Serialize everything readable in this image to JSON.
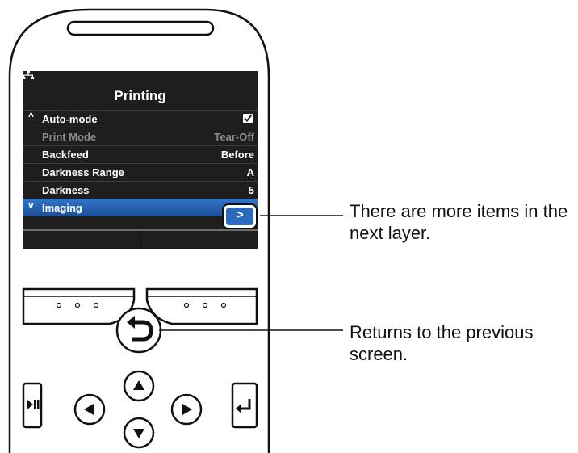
{
  "screen": {
    "title": "Printing",
    "items": [
      {
        "label": "Auto-mode",
        "value": "",
        "checked": true,
        "enabled": true,
        "prefix": "^"
      },
      {
        "label": "Print Mode",
        "value": "Tear-Off",
        "enabled": false
      },
      {
        "label": "Backfeed",
        "value": "Before",
        "enabled": true
      },
      {
        "label": "Darkness Range",
        "value": "A",
        "enabled": true
      },
      {
        "label": "Darkness",
        "value": "5",
        "enabled": true
      },
      {
        "label": "Imaging",
        "value": ">",
        "enabled": true,
        "selected": true,
        "prefix": "v"
      }
    ]
  },
  "softkeys": {
    "left": "∘ ∘ ∘",
    "right": "∘ ∘ ∘"
  },
  "callouts": {
    "more_items": "There are more items in the next layer.",
    "back": "Returns to the previous screen."
  },
  "colors": {
    "selected_row": "#2a6bbf",
    "screen_bg": "#1e1e1e"
  },
  "icons": [
    "network-icon",
    "check-icon",
    "chevron-right-icon",
    "back-icon",
    "arrow-up-icon",
    "arrow-down-icon",
    "arrow-left-icon",
    "arrow-right-icon",
    "play-pause-icon",
    "enter-icon"
  ]
}
